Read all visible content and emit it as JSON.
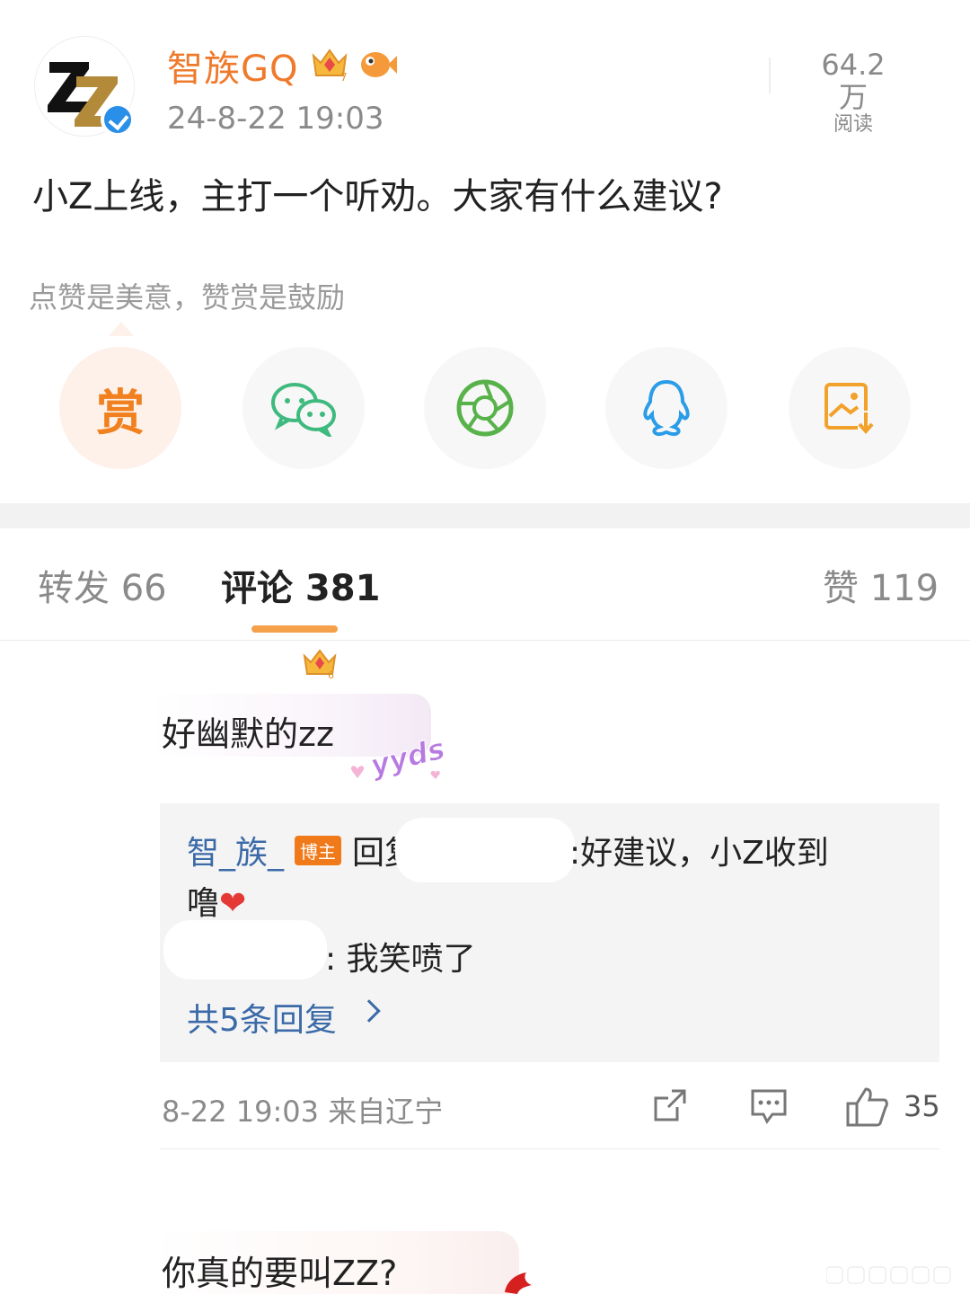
{
  "post": {
    "author": "智族GQ",
    "time": "24-8-22 19:03",
    "reads_num": "64.2万",
    "reads_label": "阅读",
    "body": "小Z上线，主打一个听劝。大家有什么建议?",
    "reward_tip": "点赞是美意，赞赏是鼓励",
    "reward_char": "赏"
  },
  "share_icons": [
    "reward-icon",
    "wechat-icon",
    "moments-icon",
    "qq-icon",
    "save-image-icon"
  ],
  "tabs": {
    "repost": "转发 66",
    "comment": "评论 381",
    "like": "赞 119"
  },
  "comment1": {
    "text": "好幽默的zz",
    "sticker": "yyds",
    "reply_name": "智_族_",
    "host_tag": "博主",
    "reply_prefix": "回复",
    "reply_suffix": ":好建议，小Z收到",
    "reply_cont": "噜",
    "heart": "❤",
    "reply2": ": 我笑喷了",
    "more_replies": "共5条回复",
    "meta": "8-22 19:03  来自辽宁",
    "likes": "35"
  },
  "comment2": {
    "text": "你真的要叫ZZ?"
  },
  "colors": {
    "author": "#ef7a2b",
    "link": "#3b6aa8",
    "tab_indicator": "#f5a04a"
  }
}
